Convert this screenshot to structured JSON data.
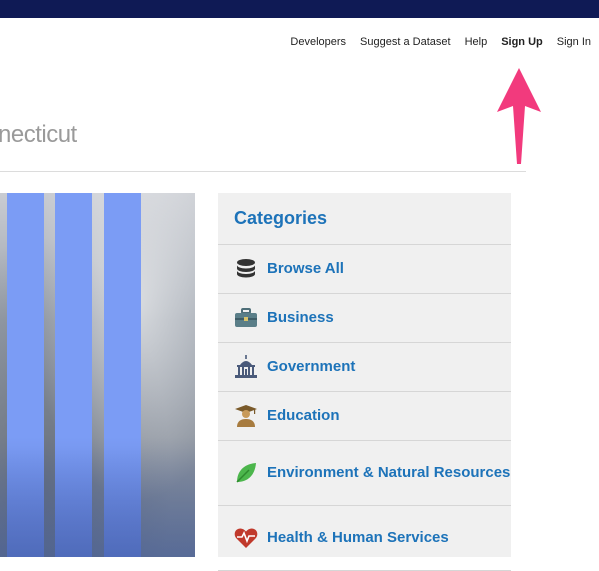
{
  "nav": {
    "items": [
      {
        "label": "Developers"
      },
      {
        "label": "Suggest a Dataset"
      },
      {
        "label": "Help"
      },
      {
        "label": "Sign Up"
      },
      {
        "label": "Sign In"
      }
    ]
  },
  "page": {
    "title": "necticut"
  },
  "colors": {
    "topbar": "#0f1a55",
    "link": "#1d73b9",
    "annotation_arrow": "#f23a7d",
    "hero_bars": "#7b9cf5"
  },
  "categories": {
    "heading": "Categories",
    "items": [
      {
        "label": "Browse All",
        "icon": "database-icon"
      },
      {
        "label": "Business",
        "icon": "briefcase-icon"
      },
      {
        "label": "Government",
        "icon": "capitol-building-icon"
      },
      {
        "label": "Education",
        "icon": "graduate-icon"
      },
      {
        "label": "Environment & Natural Resources",
        "icon": "leaf-icon"
      },
      {
        "label": "Health & Human Services",
        "icon": "heart-pulse-icon"
      }
    ]
  }
}
